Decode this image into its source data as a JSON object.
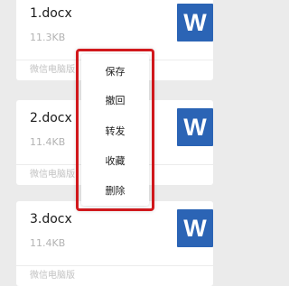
{
  "files": [
    {
      "name": "1.docx",
      "size": "11.3KB",
      "source": "微信电脑版",
      "icon": "word-icon",
      "icon_letter": "W"
    },
    {
      "name": "2.docx",
      "size": "11.4KB",
      "source": "微信电脑版",
      "icon": "word-icon",
      "icon_letter": "W"
    },
    {
      "name": "3.docx",
      "size": "11.4KB",
      "source": "微信电脑版",
      "icon": "word-icon",
      "icon_letter": "W"
    }
  ],
  "context_menu": {
    "items": [
      {
        "label": "保存"
      },
      {
        "label": "撤回"
      },
      {
        "label": "转发"
      },
      {
        "label": "收藏"
      },
      {
        "label": "删除"
      }
    ]
  },
  "colors": {
    "word_icon": "#2b64b5",
    "highlight_border": "#d2191d",
    "background": "#ebebeb"
  }
}
